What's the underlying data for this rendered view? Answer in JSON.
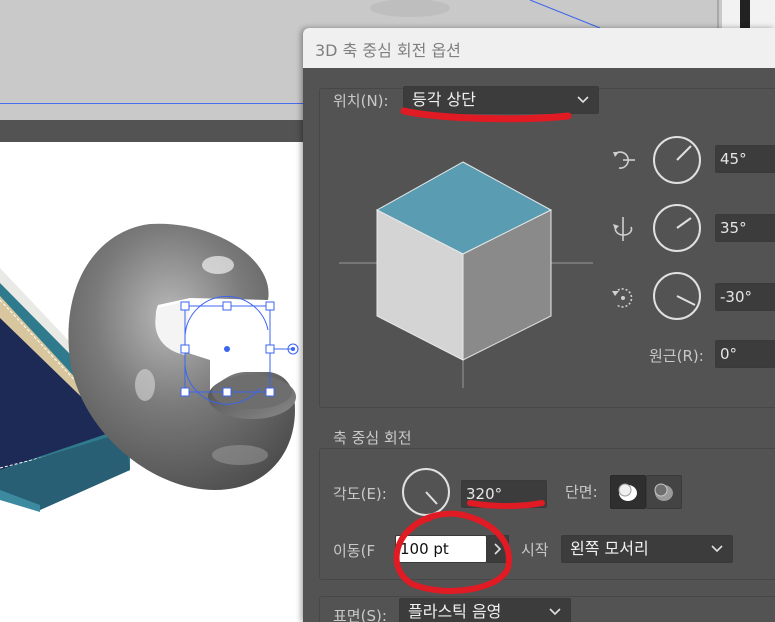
{
  "dialog": {
    "title": "3D 축 중심 회전 옵션",
    "position": {
      "label": "위치(N):",
      "value": "등각 상단"
    },
    "rotation": {
      "x_angle": "45°",
      "y_angle": "35°",
      "z_angle": "-30°",
      "perspective_label": "원근(R):",
      "perspective_value": "0°"
    },
    "revolve": {
      "section_title": "축 중심 회전",
      "angle_label": "각도(E):",
      "angle_value": "320°",
      "cap_label": "단면:",
      "offset_label": "이동(F",
      "offset_value": "100 pt",
      "from_label": "시작",
      "from_value": "왼쪽 모서리"
    },
    "surface": {
      "label": "표면(S):",
      "value": "플라스틱 음영"
    }
  },
  "colors": {
    "dialog_bg": "#535353",
    "field_bg": "#3c3c3c",
    "cube_top": "#5a9db3",
    "annotation_red": "#e01b24",
    "selection_blue": "#3c64f0"
  }
}
